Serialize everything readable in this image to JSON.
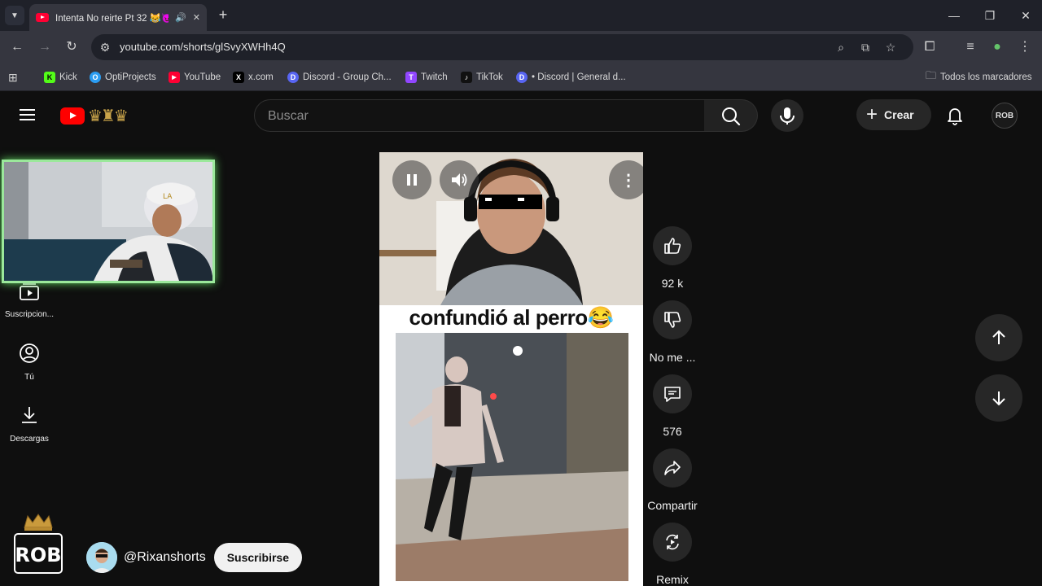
{
  "browser": {
    "tab_title": "Intenta No reirte Pt 32 😹😈",
    "url": "youtube.com/shorts/glSvyXWHh4Q",
    "bookmarks": [
      {
        "label": "Kick",
        "color": "#53fc18",
        "icon": "K"
      },
      {
        "label": "OptiProjects",
        "color": "#2b9df2",
        "icon": "O"
      },
      {
        "label": "YouTube",
        "color": "#ff0033",
        "icon": "▶"
      },
      {
        "label": "x.com",
        "color": "#000000",
        "icon": "X"
      },
      {
        "label": "Discord - Group Ch...",
        "color": "#5865f2",
        "icon": "D"
      },
      {
        "label": "Twitch",
        "color": "#9146ff",
        "icon": "T"
      },
      {
        "label": "TikTok",
        "color": "#111111",
        "icon": "♪"
      },
      {
        "label": "• Discord | General d...",
        "color": "#5865f2",
        "icon": "D"
      }
    ],
    "all_bookmarks": "Todos los marcadores"
  },
  "youtube": {
    "search_placeholder": "Buscar",
    "create_label": "Crear",
    "avatar_text": "ROB",
    "sidebar": [
      {
        "label": "Suscripcion...",
        "icon": "subscriptions-icon"
      },
      {
        "label": "Tú",
        "icon": "account-icon"
      },
      {
        "label": "Descargas",
        "icon": "download-icon"
      }
    ],
    "short": {
      "caption": "confundió al perro😂",
      "likes": "92 k",
      "dislike_label": "No me ...",
      "comments": "576",
      "share_label": "Compartir",
      "remix_label": "Remix"
    },
    "channel": {
      "handle": "@Rixanshorts",
      "subscribe_label": "Suscribirse"
    },
    "brand_logo_text": "ROB"
  },
  "colors": {
    "youtube_red": "#ff0000",
    "background": "#0f0f0f",
    "chip": "#272727",
    "webcam_border": "#9be89b"
  }
}
